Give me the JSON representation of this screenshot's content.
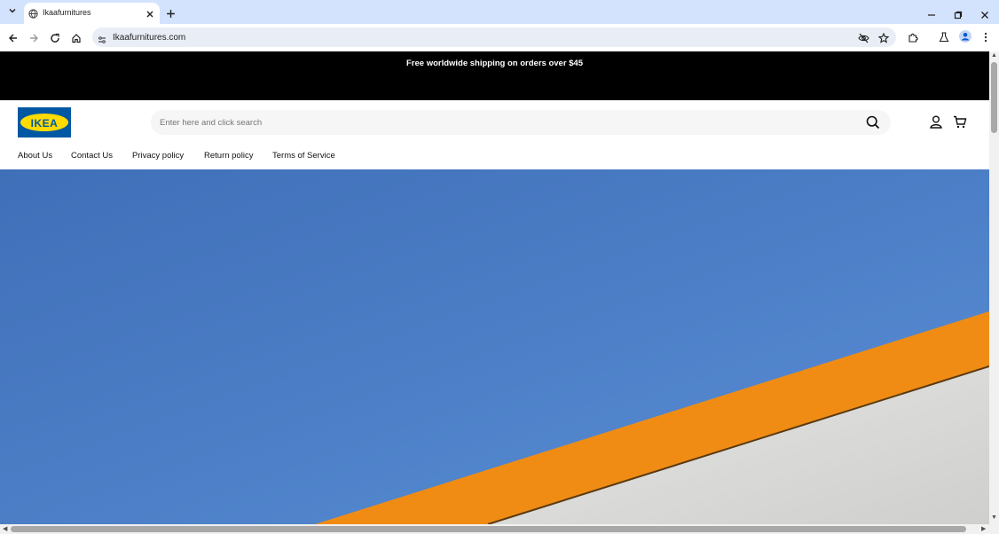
{
  "browser": {
    "tab_title": "Ikaafurnitures",
    "url": "Ikaafurnitures.com"
  },
  "announcement": {
    "text": "Free worldwide shipping on orders over $45"
  },
  "header": {
    "logo_text": "IKEA",
    "search_placeholder": "Enter here and click search"
  },
  "nav": {
    "items": [
      "About Us",
      "Contact Us",
      "Privacy policy",
      "Return policy",
      "Terms of Service"
    ]
  },
  "colors": {
    "tabstrip": "#d3e3fd",
    "announcement_bg": "#000000",
    "logo_blue": "#0058a3",
    "logo_yellow": "#ffdb00",
    "hero_sky": "#4f81c5",
    "hero_stripe": "#f08c14"
  }
}
